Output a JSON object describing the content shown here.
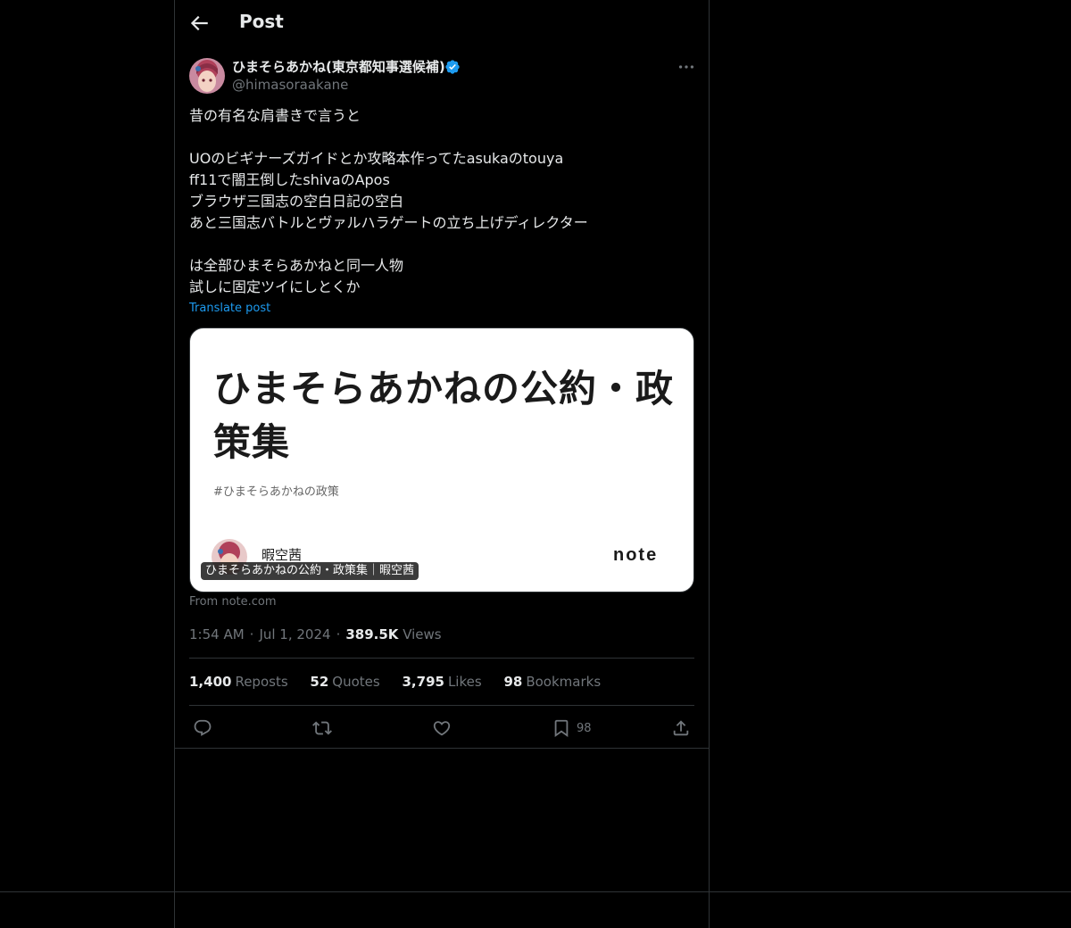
{
  "header": {
    "title": "Post"
  },
  "author": {
    "display_name": "ひまそらあかね(東京都知事選候補)",
    "handle": "@himasoraakane",
    "verified": true
  },
  "post": {
    "lines": [
      "昔の有名な肩書きで言うと",
      "",
      "UOのビギナーズガイドとか攻略本作ってたasukaのtouya",
      "ff11で闇王倒したshivaのApos",
      "ブラウザ三国志の空白日記の空白",
      "あと三国志バトルとヴァルハラゲートの立ち上げディレクター",
      "",
      "は全部ひまそらあかねと同一人物",
      "試しに固定ツイにしとくか"
    ],
    "translate_label": "Translate post"
  },
  "card": {
    "headline": "ひまそらあかねの公約・政策集",
    "hashtag": "#ひまそらあかねの政策",
    "author": "暇空茜",
    "logo": "note",
    "caption": "ひまそらあかねの公約・政策集｜暇空茜",
    "source": "From note.com"
  },
  "meta": {
    "time": "1:54 AM",
    "date": "Jul 1, 2024",
    "views_count": "389.5K",
    "views_label": "Views"
  },
  "stats": {
    "reposts_count": "1,400",
    "reposts_label": "Reposts",
    "quotes_count": "52",
    "quotes_label": "Quotes",
    "likes_count": "3,795",
    "likes_label": "Likes",
    "bookmarks_count": "98",
    "bookmarks_label": "Bookmarks"
  },
  "actions": {
    "reply": "reply-icon",
    "repost": "repost-icon",
    "like": "heart-icon",
    "bookmark": "bookmark-icon",
    "bookmark_count": "98",
    "share": "share-icon"
  },
  "colors": {
    "background": "#000000",
    "text": "#e7e9ea",
    "muted": "#71767b",
    "link": "#1d9bf0",
    "border": "#2f3336"
  }
}
